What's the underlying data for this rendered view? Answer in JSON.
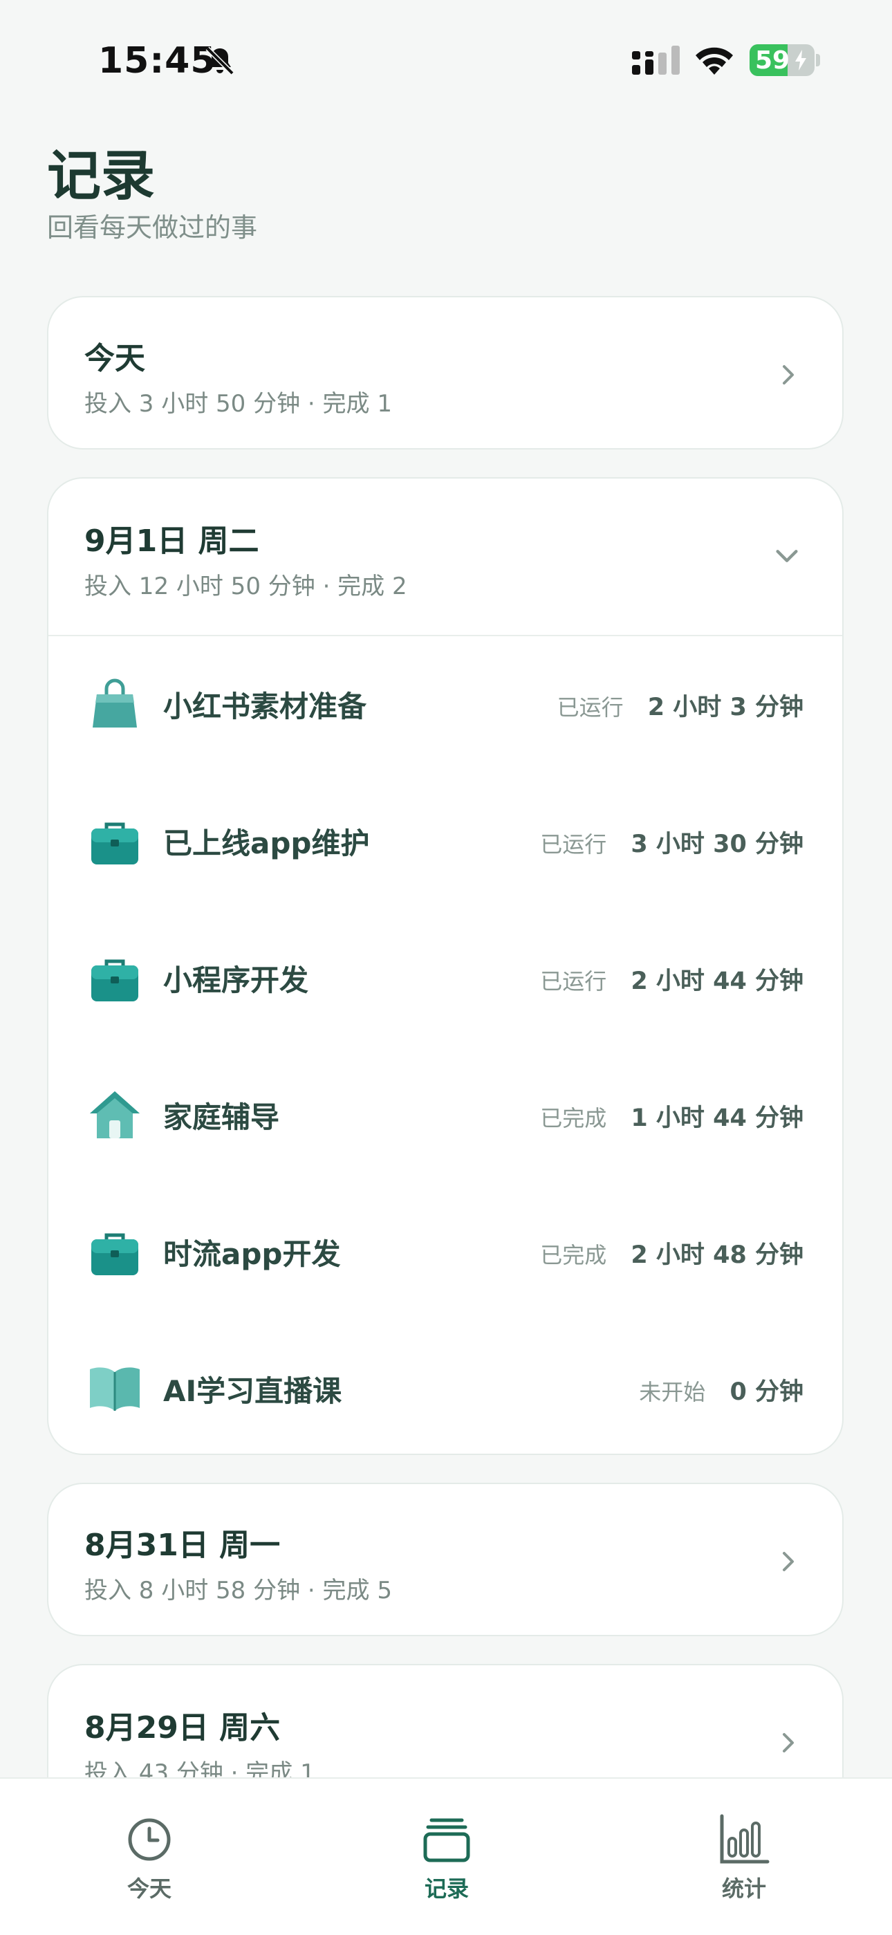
{
  "status_bar": {
    "time": "15:45",
    "battery": "59",
    "battery_level": 0.59
  },
  "header": {
    "title": "记录",
    "subtitle": "回看每天做过的事"
  },
  "days": [
    {
      "title": "今天",
      "summary": "投入 3 小时 50 分钟 · 完成 1",
      "expanded": false
    },
    {
      "title": "9月1日 周二",
      "summary": "投入 12 小时 50 分钟 · 完成 2",
      "expanded": true,
      "tasks": [
        {
          "icon": "shopping-bag-icon",
          "name": "小红书素材准备",
          "status": "已运行",
          "duration": "2 小时 3 分钟"
        },
        {
          "icon": "briefcase-icon",
          "name": "已上线app维护",
          "status": "已运行",
          "duration": "3 小时 30 分钟"
        },
        {
          "icon": "briefcase-icon",
          "name": "小程序开发",
          "status": "已运行",
          "duration": "2 小时 44 分钟"
        },
        {
          "icon": "house-icon",
          "name": "家庭辅导",
          "status": "已完成",
          "duration": "1 小时 44 分钟"
        },
        {
          "icon": "briefcase-icon",
          "name": "时流app开发",
          "status": "已完成",
          "duration": "2 小时 48 分钟"
        },
        {
          "icon": "open-book-icon",
          "name": "AI学习直播课",
          "status": "未开始",
          "duration": "0 分钟"
        }
      ]
    },
    {
      "title": "8月31日 周一",
      "summary": "投入 8 小时 58 分钟 · 完成 5",
      "expanded": false
    },
    {
      "title": "8月29日 周六",
      "summary": "投入 43 分钟 · 完成 1",
      "expanded": false
    }
  ],
  "tabbar": {
    "tabs": [
      {
        "label": "今天",
        "icon": "clock-icon",
        "active": false
      },
      {
        "label": "记录",
        "icon": "stack-icon",
        "active": true
      },
      {
        "label": "统计",
        "icon": "bar-chart-icon",
        "active": false
      }
    ]
  },
  "colors": {
    "accent": "#1d6b56",
    "inactive": "#5b6b66",
    "teal_icon": "#1f9a8c"
  }
}
